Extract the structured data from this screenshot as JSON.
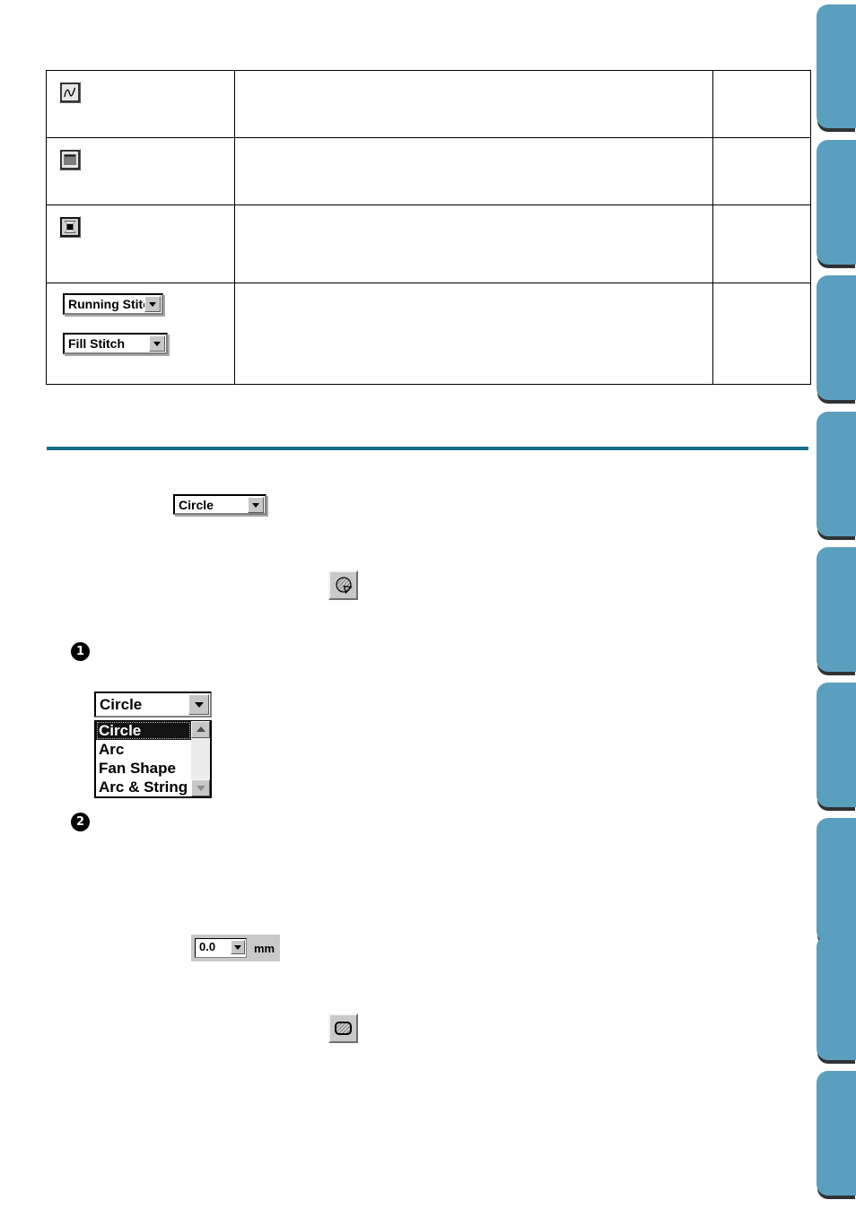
{
  "page": {
    "background_color": "#ffffff",
    "rule_color": "#14708c",
    "tab_color": "#5b9fbe",
    "tab_shadow_color": "#2f3336"
  },
  "thumb_index": {
    "name": "chapter-thumb-tabs",
    "count": 9,
    "tabs": [
      {
        "label": ""
      },
      {
        "label": ""
      },
      {
        "label": ""
      },
      {
        "label": ""
      },
      {
        "label": ""
      },
      {
        "label": ""
      },
      {
        "label": ""
      },
      {
        "label": ""
      },
      {
        "label": ""
      }
    ]
  },
  "feature_table": {
    "rows": [
      {
        "icon": "curve-line-tool-icon",
        "control_type": "icon-button",
        "description": "",
        "reference": ""
      },
      {
        "icon": "satin-stitch-tool-icon",
        "control_type": "icon-button",
        "description": "",
        "reference": ""
      },
      {
        "icon": "thread-spool-tool-icon",
        "control_type": "icon-button",
        "description": "",
        "reference": ""
      },
      {
        "control_type": "combo-pair",
        "combos": [
          {
            "name": "line-sew-type-combo",
            "value": "Running Stitch"
          },
          {
            "name": "region-sew-type-combo",
            "value": "Fill Stitch"
          }
        ],
        "description": "",
        "reference": ""
      }
    ]
  },
  "section": {
    "shape_combo_closed": {
      "name": "shape-select-combo",
      "value": "Circle"
    },
    "shape_tool_button": {
      "name": "circle-arc-shape-tool-icon"
    },
    "steps": [
      {
        "marker": "1"
      },
      {
        "marker": "2"
      }
    ],
    "shape_combo_open": {
      "name": "shape-select-combo-expanded",
      "value": "Circle",
      "options": [
        "Circle",
        "Arc",
        "Fan Shape",
        "Arc & String"
      ],
      "selected_index": 0,
      "scrollbar": {
        "up_arrow": "scroll-up-arrow-icon",
        "down_arrow": "scroll-down-arrow-icon"
      }
    },
    "measurement": {
      "name": "line-spacing-combo",
      "value": "0.0",
      "unit": "mm"
    },
    "region_fill_button": {
      "name": "region-fill-tool-icon"
    }
  }
}
